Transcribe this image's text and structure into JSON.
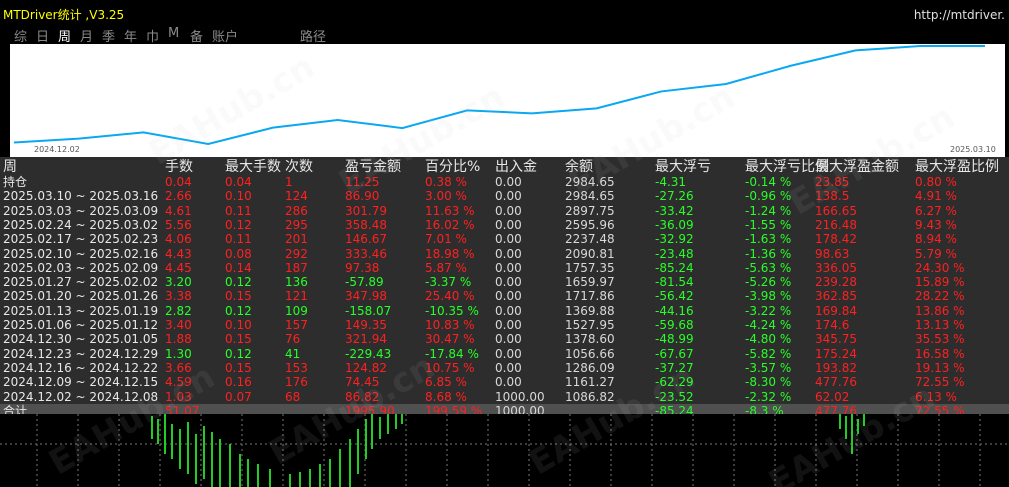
{
  "window": {
    "title": "MTDriver统计 ,V3.25",
    "url": "http://mtdriver."
  },
  "tabs": [
    {
      "label": "综",
      "active": false
    },
    {
      "label": "日",
      "active": false
    },
    {
      "label": "周",
      "active": true
    },
    {
      "label": "月",
      "active": false
    },
    {
      "label": "季",
      "active": false
    },
    {
      "label": "年",
      "active": false
    },
    {
      "label": "巾",
      "active": false
    },
    {
      "label": "M",
      "active": false
    },
    {
      "label": "备",
      "active": false
    },
    {
      "label": "账户",
      "active": false
    },
    {
      "label": "路径",
      "active": false
    }
  ],
  "chart_data": {
    "type": "line",
    "x_start_label": "2024.12.02",
    "x_end_label": "2025.03.10",
    "line_color": "#0aa8f0",
    "values": [
      1086.82,
      1161.27,
      1286.09,
      1056.66,
      1378.6,
      1527.95,
      1369.88,
      1717.86,
      1659.97,
      1757.35,
      2090.81,
      2237.48,
      2595.96,
      2897.75,
      2984.65,
      2984.65
    ]
  },
  "table": {
    "columns": [
      "周",
      "手数",
      "最大手数",
      "次数",
      "盈亏金额",
      "百分比%",
      "出入金",
      "余额",
      "最大浮亏",
      "最大浮亏比例",
      "最大浮盈金额",
      "最大浮盈比例"
    ],
    "rows": [
      {
        "period": "持仓",
        "lots": "0.04",
        "maxlots": "0.04",
        "count": "1",
        "pnl": "11.25",
        "pct": "0.38 %",
        "inout": "0.00",
        "balance": "2984.65",
        "maxdd": "-4.31",
        "maxddpct": "-0.14 %",
        "maxprofit": "23.85",
        "maxprofitpct": "0.80 %",
        "pos": true
      },
      {
        "period": "2025.03.10 ~ 2025.03.16",
        "lots": "2.66",
        "maxlots": "0.10",
        "count": "124",
        "pnl": "86.90",
        "pct": "3.00 %",
        "inout": "0.00",
        "balance": "2984.65",
        "maxdd": "-27.26",
        "maxddpct": "-0.96 %",
        "maxprofit": "138.5",
        "maxprofitpct": "4.91 %",
        "pos": true
      },
      {
        "period": "2025.03.03 ~ 2025.03.09",
        "lots": "4.61",
        "maxlots": "0.11",
        "count": "286",
        "pnl": "301.79",
        "pct": "11.63 %",
        "inout": "0.00",
        "balance": "2897.75",
        "maxdd": "-33.42",
        "maxddpct": "-1.24 %",
        "maxprofit": "166.65",
        "maxprofitpct": "6.27 %",
        "pos": true
      },
      {
        "period": "2025.02.24 ~ 2025.03.02",
        "lots": "5.56",
        "maxlots": "0.12",
        "count": "295",
        "pnl": "358.48",
        "pct": "16.02 %",
        "inout": "0.00",
        "balance": "2595.96",
        "maxdd": "-36.09",
        "maxddpct": "-1.55 %",
        "maxprofit": "216.48",
        "maxprofitpct": "9.43 %",
        "pos": true
      },
      {
        "period": "2025.02.17 ~ 2025.02.23",
        "lots": "4.06",
        "maxlots": "0.11",
        "count": "201",
        "pnl": "146.67",
        "pct": "7.01 %",
        "inout": "0.00",
        "balance": "2237.48",
        "maxdd": "-32.92",
        "maxddpct": "-1.63 %",
        "maxprofit": "178.42",
        "maxprofitpct": "8.94 %",
        "pos": true
      },
      {
        "period": "2025.02.10 ~ 2025.02.16",
        "lots": "4.43",
        "maxlots": "0.08",
        "count": "292",
        "pnl": "333.46",
        "pct": "18.98 %",
        "inout": "0.00",
        "balance": "2090.81",
        "maxdd": "-23.48",
        "maxddpct": "-1.36 %",
        "maxprofit": "98.63",
        "maxprofitpct": "5.79 %",
        "pos": true
      },
      {
        "period": "2025.02.03 ~ 2025.02.09",
        "lots": "4.45",
        "maxlots": "0.14",
        "count": "187",
        "pnl": "97.38",
        "pct": "5.87 %",
        "inout": "0.00",
        "balance": "1757.35",
        "maxdd": "-85.24",
        "maxddpct": "-5.63 %",
        "maxprofit": "336.05",
        "maxprofitpct": "24.30 %",
        "pos": true
      },
      {
        "period": "2025.01.27 ~ 2025.02.02",
        "lots": "3.20",
        "maxlots": "0.12",
        "count": "136",
        "pnl": "-57.89",
        "pct": "-3.37 %",
        "inout": "0.00",
        "balance": "1659.97",
        "maxdd": "-81.54",
        "maxddpct": "-5.26 %",
        "maxprofit": "239.28",
        "maxprofitpct": "15.89 %",
        "pos": false
      },
      {
        "period": "2025.01.20 ~ 2025.01.26",
        "lots": "3.38",
        "maxlots": "0.15",
        "count": "121",
        "pnl": "347.98",
        "pct": "25.40 %",
        "inout": "0.00",
        "balance": "1717.86",
        "maxdd": "-56.42",
        "maxddpct": "-3.98 %",
        "maxprofit": "362.85",
        "maxprofitpct": "28.22 %",
        "pos": true
      },
      {
        "period": "2025.01.13 ~ 2025.01.19",
        "lots": "2.82",
        "maxlots": "0.12",
        "count": "109",
        "pnl": "-158.07",
        "pct": "-10.35 %",
        "inout": "0.00",
        "balance": "1369.88",
        "maxdd": "-44.16",
        "maxddpct": "-3.22 %",
        "maxprofit": "169.84",
        "maxprofitpct": "13.86 %",
        "pos": false
      },
      {
        "period": "2025.01.06 ~ 2025.01.12",
        "lots": "3.40",
        "maxlots": "0.10",
        "count": "157",
        "pnl": "149.35",
        "pct": "10.83 %",
        "inout": "0.00",
        "balance": "1527.95",
        "maxdd": "-59.68",
        "maxddpct": "-4.24 %",
        "maxprofit": "174.6",
        "maxprofitpct": "13.13 %",
        "pos": true
      },
      {
        "period": "2024.12.30 ~ 2025.01.05",
        "lots": "1.88",
        "maxlots": "0.15",
        "count": "76",
        "pnl": "321.94",
        "pct": "30.47 %",
        "inout": "0.00",
        "balance": "1378.60",
        "maxdd": "-48.99",
        "maxddpct": "-4.80 %",
        "maxprofit": "345.75",
        "maxprofitpct": "35.53 %",
        "pos": true
      },
      {
        "period": "2024.12.23 ~ 2024.12.29",
        "lots": "1.30",
        "maxlots": "0.12",
        "count": "41",
        "pnl": "-229.43",
        "pct": "-17.84 %",
        "inout": "0.00",
        "balance": "1056.66",
        "maxdd": "-67.67",
        "maxddpct": "-5.82 %",
        "maxprofit": "175.24",
        "maxprofitpct": "16.58 %",
        "pos": false
      },
      {
        "period": "2024.12.16 ~ 2024.12.22",
        "lots": "3.66",
        "maxlots": "0.15",
        "count": "153",
        "pnl": "124.82",
        "pct": "10.75 %",
        "inout": "0.00",
        "balance": "1286.09",
        "maxdd": "-37.27",
        "maxddpct": "-3.57 %",
        "maxprofit": "193.82",
        "maxprofitpct": "19.13 %",
        "pos": true
      },
      {
        "period": "2024.12.09 ~ 2024.12.15",
        "lots": "4.59",
        "maxlots": "0.16",
        "count": "176",
        "pnl": "74.45",
        "pct": "6.85 %",
        "inout": "0.00",
        "balance": "1161.27",
        "maxdd": "-62.29",
        "maxddpct": "-8.30 %",
        "maxprofit": "477.76",
        "maxprofitpct": "72.55 %",
        "pos": true
      },
      {
        "period": "2024.12.02 ~ 2024.12.08",
        "lots": "1.03",
        "maxlots": "0.07",
        "count": "68",
        "pnl": "86.82",
        "pct": "8.68 %",
        "inout": "1000.00",
        "balance": "1086.82",
        "maxdd": "-23.52",
        "maxddpct": "-2.32 %",
        "maxprofit": "62.02",
        "maxprofitpct": "6.13 %",
        "pos": true
      }
    ],
    "total": {
      "period": "合计",
      "lots": "51.07",
      "maxlots": "",
      "count": "",
      "pnl": "1995.90",
      "pct": "199.59 %",
      "inout": "1000.00",
      "balance": "",
      "maxdd": "-85.24",
      "maxddpct": "-8.3 %",
      "maxprofit": "477.76",
      "maxprofitpct": "72.55 %"
    }
  },
  "watermark": "EAHub.cn",
  "colors": {
    "positive": "#ff2020",
    "negative": "#28ff28",
    "neutral": "#d8d8d8",
    "title": "#ffff00",
    "table_bg": "#2d2d2d"
  }
}
